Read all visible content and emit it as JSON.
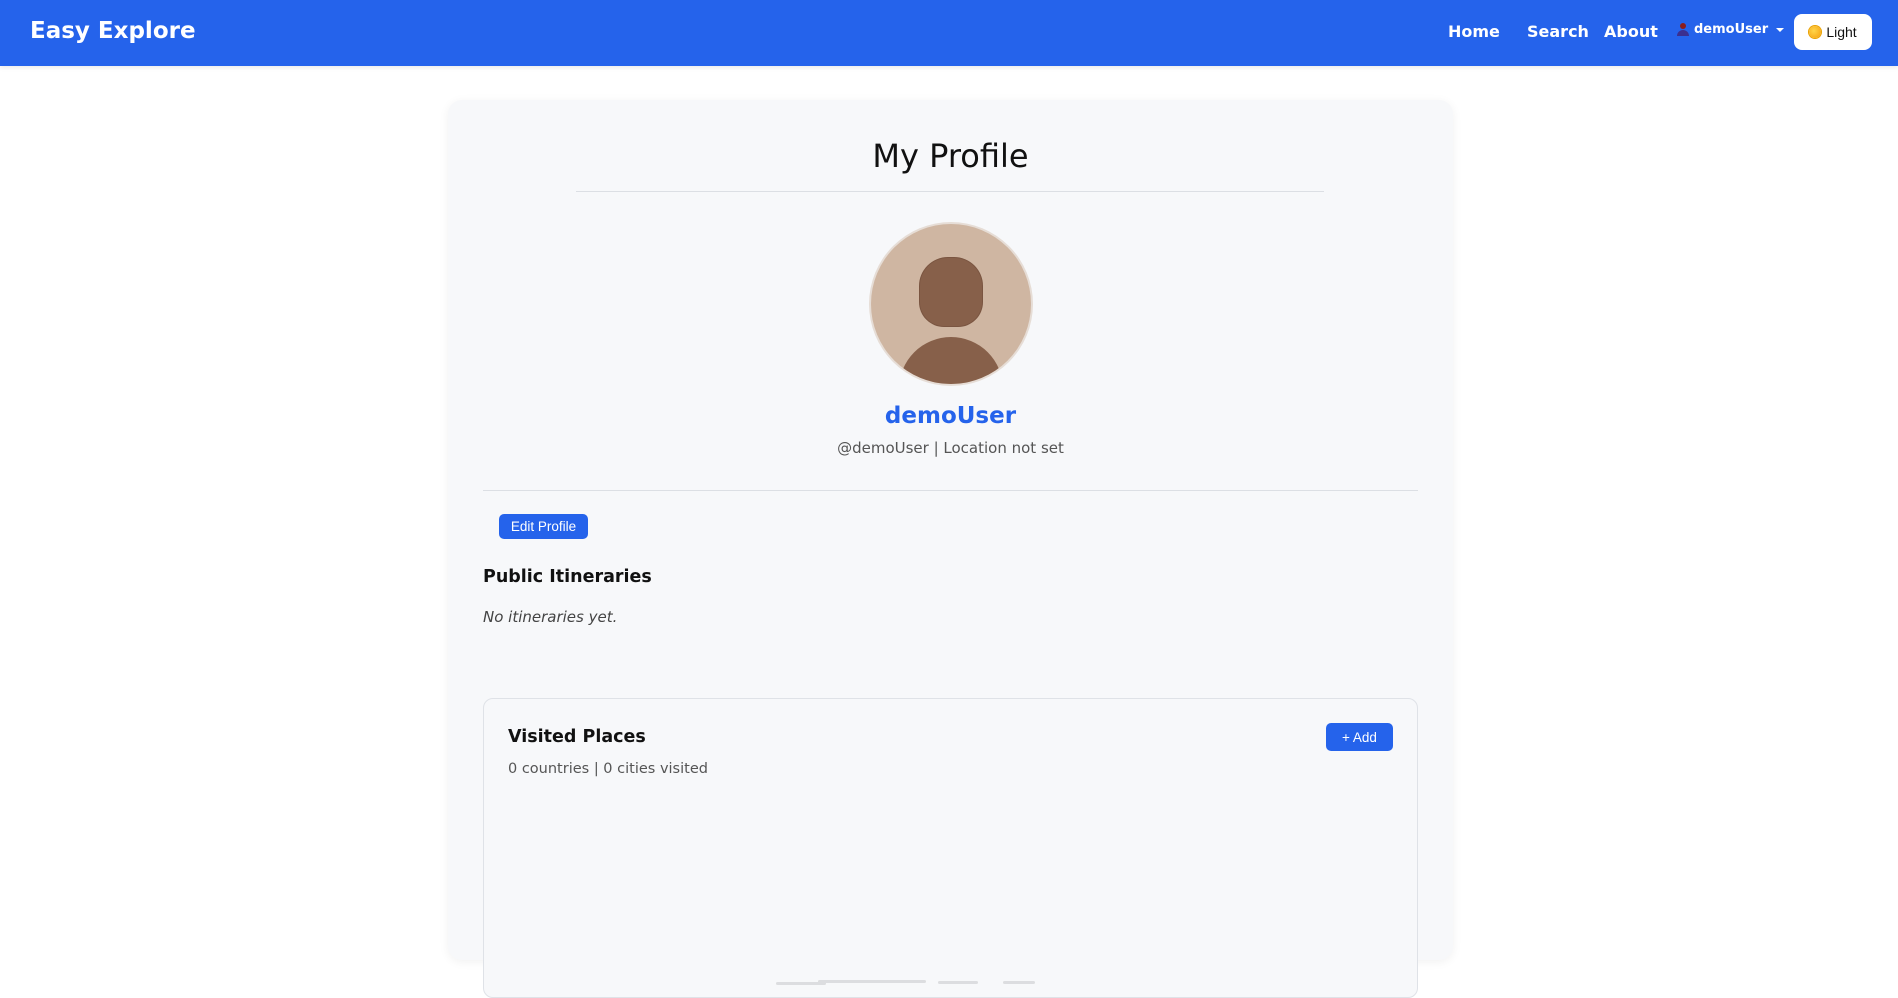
{
  "navbar": {
    "brand": "Easy Explore",
    "links": [
      "Home",
      "Search",
      "About"
    ],
    "user": "demoUser",
    "theme_label": "Light"
  },
  "profile": {
    "title": "My Profile",
    "name": "demoUser",
    "meta": "@demoUser | Location not set",
    "edit_label": "Edit Profile"
  },
  "itineraries": {
    "title": "Public Itineraries",
    "empty": "No itineraries yet."
  },
  "visited": {
    "title": "Visited Places",
    "stats": "0 countries | 0 cities visited",
    "add_label": "+ Add"
  },
  "colors": {
    "primary": "#2563eb",
    "card_bg": "#f7f8fa"
  }
}
